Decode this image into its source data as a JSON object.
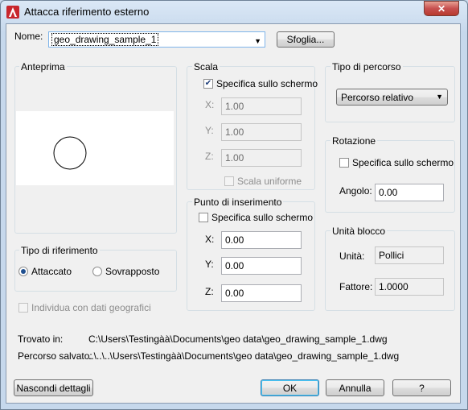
{
  "window": {
    "title": "Attacca riferimento esterno",
    "close": "✕"
  },
  "name": {
    "label": "Nome:",
    "value": "geo_drawing_sample_1",
    "browse": "Sfoglia..."
  },
  "preview": {
    "label": "Anteprima"
  },
  "scale": {
    "label": "Scala",
    "specify": "Specifica sullo schermo",
    "x_label": "X:",
    "x_value": "1.00",
    "y_label": "Y:",
    "y_value": "1.00",
    "z_label": "Z:",
    "z_value": "1.00",
    "uniform": "Scala uniforme"
  },
  "insertion": {
    "label": "Punto di inserimento",
    "specify": "Specifica sullo schermo",
    "x_label": "X:",
    "x_value": "0.00",
    "y_label": "Y:",
    "y_value": "0.00",
    "z_label": "Z:",
    "z_value": "0.00"
  },
  "path_type": {
    "label": "Tipo di percorso",
    "value": "Percorso relativo"
  },
  "rotation": {
    "label": "Rotazione",
    "specify": "Specifica sullo schermo",
    "angle_label": "Angolo:",
    "angle_value": "0.00"
  },
  "block_unit": {
    "label": "Unità blocco",
    "unit_label": "Unità:",
    "unit_value": "Pollici",
    "factor_label": "Fattore:",
    "factor_value": "1.0000"
  },
  "reference_type": {
    "label": "Tipo di riferimento",
    "attach": "Attaccato",
    "overlay": "Sovrapposto"
  },
  "geo": {
    "label": "Individua con dati geografici"
  },
  "found_in": {
    "label": "Trovato in:",
    "value": "C:\\Users\\Testingàà\\Documents\\geo data\\geo_drawing_sample_1.dwg"
  },
  "saved_path": {
    "label": "Percorso salvato:",
    "value": "..\\..\\..\\Users\\Testingàà\\Documents\\geo data\\geo_drawing_sample_1.dwg"
  },
  "buttons": {
    "details": "Nascondi dettagli",
    "ok": "OK",
    "cancel": "Annulla",
    "help": "?"
  }
}
